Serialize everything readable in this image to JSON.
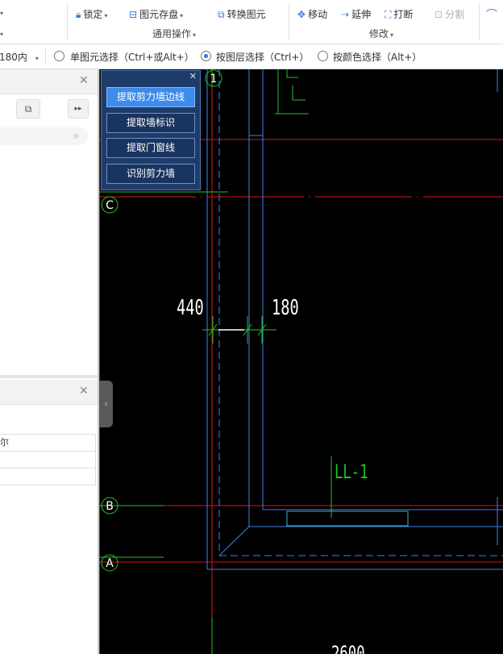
{
  "ribbon": {
    "lock": "锁定",
    "save_element": "图元存盘",
    "convert": "转换图元",
    "group_general": "通用操作",
    "move": "移动",
    "extend": "延伸",
    "break": "打断",
    "split": "分割",
    "group_modify": "修改"
  },
  "options": {
    "dropdown_value": "180内",
    "single_select": "单图元选择（Ctrl+或Alt+）",
    "layer_select": "按图层选择（Ctrl+）",
    "color_select": "按颜色选择（Alt+）",
    "selected": "layer_select"
  },
  "left_panel": {
    "field_partial": "尔"
  },
  "popup": {
    "buttons": [
      "提取剪力墙边线",
      "提取墙标识",
      "提取门窗线",
      "识别剪力墙"
    ],
    "active_index": 0
  },
  "drawing": {
    "axis_1": "1",
    "axis_c": "C",
    "axis_b": "B",
    "axis_a": "A",
    "dim_left": "440",
    "dim_right": "180",
    "label_ll": "LL-1",
    "label_bottom": "2600"
  },
  "colors": {
    "background": "#000000",
    "axis_red": "#d01818",
    "axis_green": "#22c422",
    "wall_blue": "#3e82e8",
    "dim_white": "#ffffff",
    "popup_active": "#3d8bec"
  }
}
